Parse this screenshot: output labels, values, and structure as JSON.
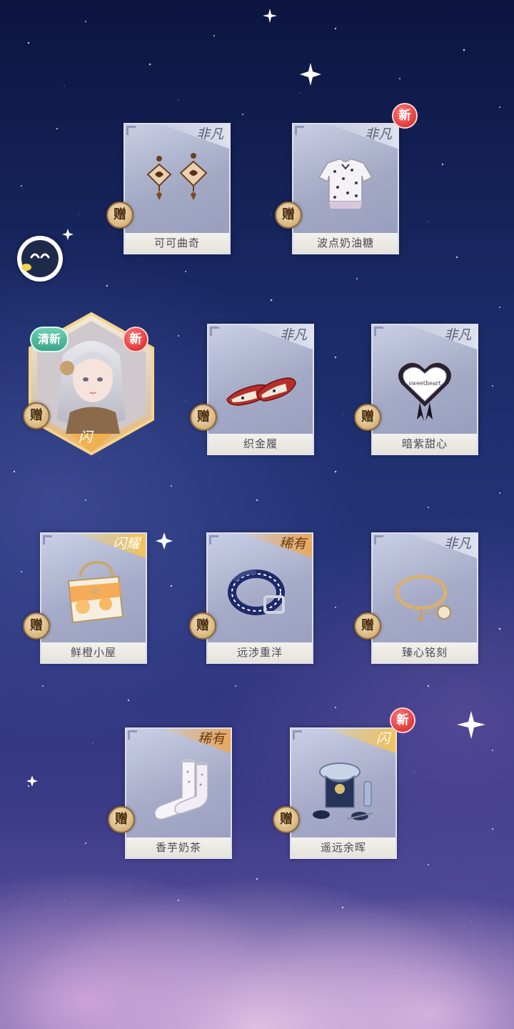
{
  "colors": {
    "sky_top": "#0c1540",
    "sky_mid": "#243478",
    "sky_bottom": "#6a5aa6",
    "gift_badge": "#d6b27a",
    "new_badge": "#e03838",
    "fresh_badge": "#3aa58a"
  },
  "badges": {
    "gift": "赠",
    "new": "新",
    "fresh": "清新"
  },
  "avatar": {
    "icon": "face-icon"
  },
  "featured": {
    "rarity": "闪",
    "icon": "character-portrait"
  },
  "items": [
    {
      "name": "可可曲奇",
      "rarity": "非凡",
      "icon": "cookie-earrings-icon",
      "is_new": false
    },
    {
      "name": "波点奶油糖",
      "rarity": "非凡",
      "icon": "polka-dot-top-icon",
      "is_new": true
    },
    {
      "name": "织金履",
      "rarity": "非凡",
      "icon": "red-shoes-icon",
      "is_new": false
    },
    {
      "name": "暗紫甜心",
      "rarity": "非凡",
      "icon": "heart-accessory-icon",
      "is_new": false
    },
    {
      "name": "鲜橙小屋",
      "rarity": "闪耀",
      "icon": "orange-handbag-icon",
      "is_new": false
    },
    {
      "name": "远涉重洋",
      "rarity": "稀有",
      "icon": "blue-belt-icon",
      "is_new": false
    },
    {
      "name": "臻心铭刻",
      "rarity": "非凡",
      "icon": "gold-bracelet-icon",
      "is_new": false
    },
    {
      "name": "香芋奶茶",
      "rarity": "稀有",
      "icon": "white-socks-icon",
      "is_new": false
    },
    {
      "name": "遥远余晖",
      "rarity": "闪",
      "icon": "vanity-set-icon",
      "is_new": true
    }
  ]
}
